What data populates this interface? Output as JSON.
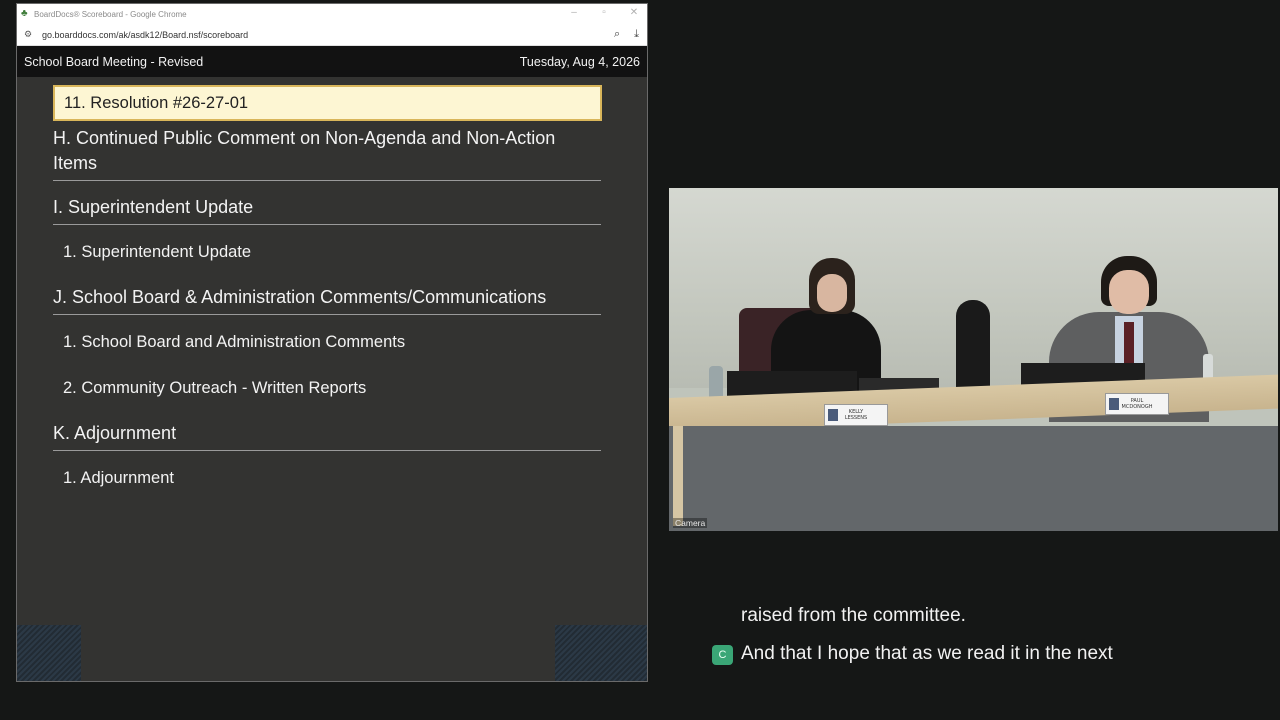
{
  "window": {
    "title": "BoardDocs® Scoreboard - Google Chrome",
    "url": "go.boarddocs.com/ak/asdk12/Board.nsf/scoreboard",
    "controls": [
      "minimize-icon",
      "maximize-icon",
      "close-icon"
    ]
  },
  "header": {
    "meeting": "School Board Meeting - Revised",
    "date": "Tuesday, Aug 4, 2026"
  },
  "agenda": {
    "current_item": "11. Resolution #26-27-01",
    "sections": [
      {
        "title": "H. Continued Public Comment on Non-Agenda and Non-Action Items",
        "items": []
      },
      {
        "title": "I. Superintendent Update",
        "items": [
          "1. Superintendent Update"
        ]
      },
      {
        "title": "J. School Board & Administration Comments/Communications",
        "items": [
          "1. School Board and Administration Comments",
          "2. Community Outreach - Written Reports"
        ]
      },
      {
        "title": "K. Adjournment",
        "items": [
          "1. Adjournment"
        ]
      }
    ]
  },
  "video": {
    "label": "Camera",
    "nameplates": [
      {
        "line1": "KELLY",
        "line2": "LESSENS"
      },
      {
        "line1": "PAUL",
        "line2": "MCDONOGH"
      }
    ]
  },
  "captions": {
    "badge": "C",
    "line1": "raised from the committee.",
    "line2": "And that I hope that as we read it in the next"
  }
}
